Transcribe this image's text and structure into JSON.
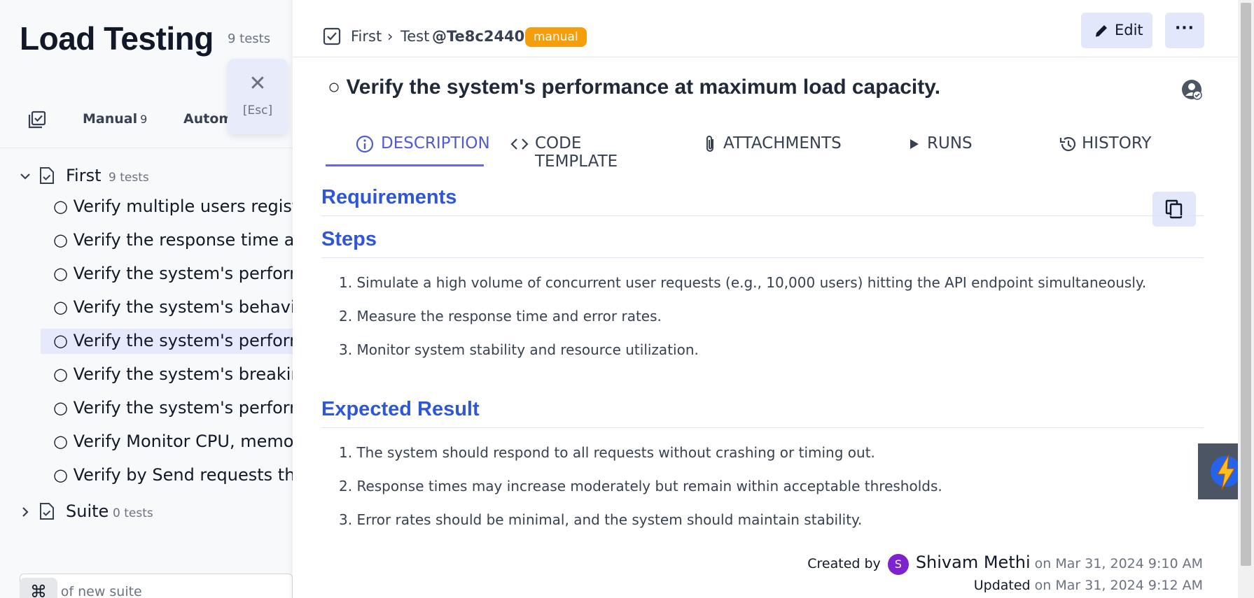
{
  "project": {
    "title": "Load Testing",
    "count": "9 tests"
  },
  "filters": {
    "manual_label": "Manual",
    "manual_count": "9",
    "auto_label": "Autom"
  },
  "esc": {
    "icon": "close-icon",
    "label": "[Esc]"
  },
  "tree": {
    "suites": [
      {
        "name": "First",
        "count": "9 tests",
        "expanded": true
      },
      {
        "name": "Suite",
        "count": "0 tests",
        "expanded": false
      }
    ],
    "tests": [
      "○ Verify multiple users register",
      "○ Verify the response time and",
      "○ Verify the system's performa",
      "○ Verify the system's behavior",
      "○ Verify the system's performa",
      "○ Verify the system's breaking",
      "○ Verify the system's performa",
      "○ Verify Monitor CPU, memory,",
      "○ Verify by Send requests that"
    ],
    "selected_index": 4,
    "new_suite_placeholder": "e of new suite",
    "cmd_key": "⌘"
  },
  "header": {
    "crumb_suite": "First",
    "crumb_sep": "›",
    "crumb_test": "Test",
    "test_id": "@Te8c24402",
    "badge": "manual",
    "edit_label": "Edit",
    "more_label": "···"
  },
  "test": {
    "title": "○ Verify the system's performance at maximum load capacity."
  },
  "tabs": [
    {
      "label": "DESCRIPTION",
      "icon": "info-icon",
      "active": true
    },
    {
      "label": "CODE TEMPLATE",
      "icon": "code-icon",
      "active": false
    },
    {
      "label": "ATTACHMENTS",
      "icon": "paperclip-icon",
      "active": false
    },
    {
      "label": "RUNS",
      "icon": "play-icon",
      "active": false
    },
    {
      "label": "HISTORY",
      "icon": "history-icon",
      "active": false
    }
  ],
  "description": {
    "requirements_heading": "Requirements",
    "steps_heading": "Steps",
    "steps": [
      "1. Simulate a high volume of concurrent user requests (e.g., 10,000 users) hitting the API endpoint simultaneously.",
      "2. Measure the response time and error rates.",
      "3. Monitor system stability and resource utilization."
    ],
    "expected_heading": "Expected Result",
    "expected": [
      "1. The system should respond to all requests without crashing or timing out.",
      "2. Response times may increase moderately but remain within acceptable thresholds.",
      "3. Error rates should be minimal, and the system should maintain stability."
    ]
  },
  "meta": {
    "created_label": "Created by",
    "avatar_initial": "S",
    "author": "Shivam Methi",
    "created_date": "on Mar 31, 2024 9:10 AM",
    "updated_label": "Updated",
    "updated_date": "on Mar 31, 2024 9:12 AM"
  },
  "colors": {
    "accent": "#6366f1",
    "heading": "#2f56d9",
    "badge": "#f59e0b",
    "avatar": "#7e22ce"
  }
}
